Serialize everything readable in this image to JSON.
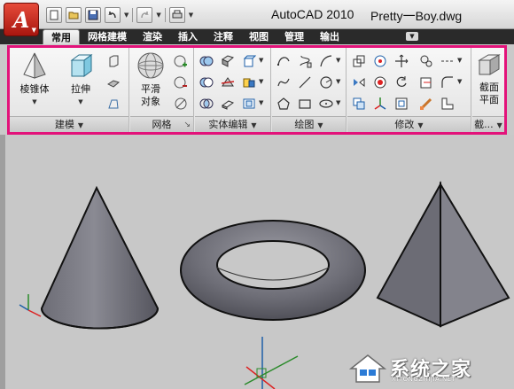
{
  "titlebar": {
    "app_button_glyph": "A",
    "app_title": "AutoCAD 2010",
    "file_title": "Pretty一Boy.dwg",
    "quick_access": [
      "new-icon",
      "open-icon",
      "save-icon",
      "undo-icon",
      "redo-icon",
      "plot-icon"
    ]
  },
  "ribbon_tabs": [
    {
      "label": "常用",
      "active": true
    },
    {
      "label": "网格建模",
      "active": false
    },
    {
      "label": "渲染",
      "active": false
    },
    {
      "label": "插入",
      "active": false
    },
    {
      "label": "注释",
      "active": false
    },
    {
      "label": "视图",
      "active": false
    },
    {
      "label": "管理",
      "active": false
    },
    {
      "label": "输出",
      "active": false
    }
  ],
  "panels": {
    "modeling": {
      "label": "建模",
      "pyramid_button": "棱锥体",
      "extrude_button": "拉伸"
    },
    "mesh": {
      "label": "网格",
      "smooth_object_line1": "平滑",
      "smooth_object_line2": "对象"
    },
    "solid_editing": {
      "label": "实体编辑"
    },
    "draw": {
      "label": "绘图"
    },
    "modify": {
      "label": "修改"
    },
    "section": {
      "label": "截...",
      "section_plane_line1": "截面",
      "section_plane_line2": "平面"
    }
  },
  "highlight_color": "#e3127a",
  "watermark": {
    "text": "系统之家",
    "subtext": "XITONGZHIJIA.NET"
  }
}
